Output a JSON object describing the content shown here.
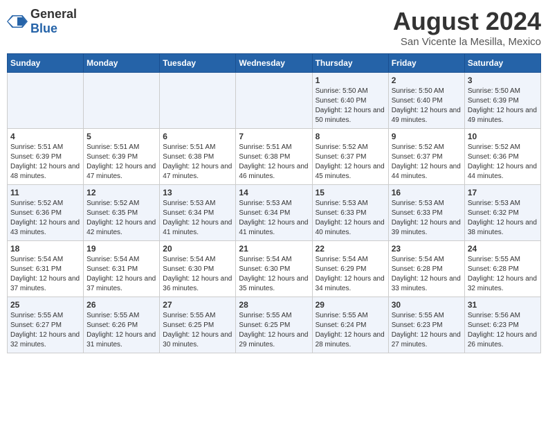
{
  "header": {
    "logo_general": "General",
    "logo_blue": "Blue",
    "month_title": "August 2024",
    "location": "San Vicente la Mesilla, Mexico"
  },
  "days_of_week": [
    "Sunday",
    "Monday",
    "Tuesday",
    "Wednesday",
    "Thursday",
    "Friday",
    "Saturday"
  ],
  "weeks": [
    [
      {
        "day": "",
        "info": ""
      },
      {
        "day": "",
        "info": ""
      },
      {
        "day": "",
        "info": ""
      },
      {
        "day": "",
        "info": ""
      },
      {
        "day": "1",
        "info": "Sunrise: 5:50 AM\nSunset: 6:40 PM\nDaylight: 12 hours\nand 50 minutes."
      },
      {
        "day": "2",
        "info": "Sunrise: 5:50 AM\nSunset: 6:40 PM\nDaylight: 12 hours\nand 49 minutes."
      },
      {
        "day": "3",
        "info": "Sunrise: 5:50 AM\nSunset: 6:39 PM\nDaylight: 12 hours\nand 49 minutes."
      }
    ],
    [
      {
        "day": "4",
        "info": "Sunrise: 5:51 AM\nSunset: 6:39 PM\nDaylight: 12 hours\nand 48 minutes."
      },
      {
        "day": "5",
        "info": "Sunrise: 5:51 AM\nSunset: 6:39 PM\nDaylight: 12 hours\nand 47 minutes."
      },
      {
        "day": "6",
        "info": "Sunrise: 5:51 AM\nSunset: 6:38 PM\nDaylight: 12 hours\nand 47 minutes."
      },
      {
        "day": "7",
        "info": "Sunrise: 5:51 AM\nSunset: 6:38 PM\nDaylight: 12 hours\nand 46 minutes."
      },
      {
        "day": "8",
        "info": "Sunrise: 5:52 AM\nSunset: 6:37 PM\nDaylight: 12 hours\nand 45 minutes."
      },
      {
        "day": "9",
        "info": "Sunrise: 5:52 AM\nSunset: 6:37 PM\nDaylight: 12 hours\nand 44 minutes."
      },
      {
        "day": "10",
        "info": "Sunrise: 5:52 AM\nSunset: 6:36 PM\nDaylight: 12 hours\nand 44 minutes."
      }
    ],
    [
      {
        "day": "11",
        "info": "Sunrise: 5:52 AM\nSunset: 6:36 PM\nDaylight: 12 hours\nand 43 minutes."
      },
      {
        "day": "12",
        "info": "Sunrise: 5:52 AM\nSunset: 6:35 PM\nDaylight: 12 hours\nand 42 minutes."
      },
      {
        "day": "13",
        "info": "Sunrise: 5:53 AM\nSunset: 6:34 PM\nDaylight: 12 hours\nand 41 minutes."
      },
      {
        "day": "14",
        "info": "Sunrise: 5:53 AM\nSunset: 6:34 PM\nDaylight: 12 hours\nand 41 minutes."
      },
      {
        "day": "15",
        "info": "Sunrise: 5:53 AM\nSunset: 6:33 PM\nDaylight: 12 hours\nand 40 minutes."
      },
      {
        "day": "16",
        "info": "Sunrise: 5:53 AM\nSunset: 6:33 PM\nDaylight: 12 hours\nand 39 minutes."
      },
      {
        "day": "17",
        "info": "Sunrise: 5:53 AM\nSunset: 6:32 PM\nDaylight: 12 hours\nand 38 minutes."
      }
    ],
    [
      {
        "day": "18",
        "info": "Sunrise: 5:54 AM\nSunset: 6:31 PM\nDaylight: 12 hours\nand 37 minutes."
      },
      {
        "day": "19",
        "info": "Sunrise: 5:54 AM\nSunset: 6:31 PM\nDaylight: 12 hours\nand 37 minutes."
      },
      {
        "day": "20",
        "info": "Sunrise: 5:54 AM\nSunset: 6:30 PM\nDaylight: 12 hours\nand 36 minutes."
      },
      {
        "day": "21",
        "info": "Sunrise: 5:54 AM\nSunset: 6:30 PM\nDaylight: 12 hours\nand 35 minutes."
      },
      {
        "day": "22",
        "info": "Sunrise: 5:54 AM\nSunset: 6:29 PM\nDaylight: 12 hours\nand 34 minutes."
      },
      {
        "day": "23",
        "info": "Sunrise: 5:54 AM\nSunset: 6:28 PM\nDaylight: 12 hours\nand 33 minutes."
      },
      {
        "day": "24",
        "info": "Sunrise: 5:55 AM\nSunset: 6:28 PM\nDaylight: 12 hours\nand 32 minutes."
      }
    ],
    [
      {
        "day": "25",
        "info": "Sunrise: 5:55 AM\nSunset: 6:27 PM\nDaylight: 12 hours\nand 32 minutes."
      },
      {
        "day": "26",
        "info": "Sunrise: 5:55 AM\nSunset: 6:26 PM\nDaylight: 12 hours\nand 31 minutes."
      },
      {
        "day": "27",
        "info": "Sunrise: 5:55 AM\nSunset: 6:25 PM\nDaylight: 12 hours\nand 30 minutes."
      },
      {
        "day": "28",
        "info": "Sunrise: 5:55 AM\nSunset: 6:25 PM\nDaylight: 12 hours\nand 29 minutes."
      },
      {
        "day": "29",
        "info": "Sunrise: 5:55 AM\nSunset: 6:24 PM\nDaylight: 12 hours\nand 28 minutes."
      },
      {
        "day": "30",
        "info": "Sunrise: 5:55 AM\nSunset: 6:23 PM\nDaylight: 12 hours\nand 27 minutes."
      },
      {
        "day": "31",
        "info": "Sunrise: 5:56 AM\nSunset: 6:23 PM\nDaylight: 12 hours\nand 26 minutes."
      }
    ]
  ]
}
